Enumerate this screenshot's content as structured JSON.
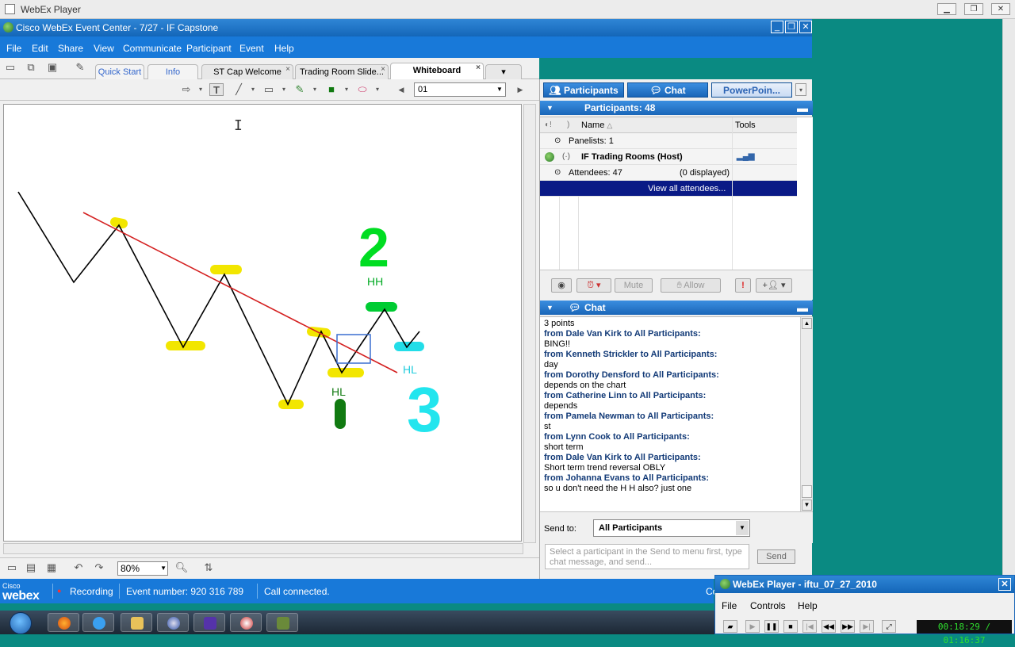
{
  "outer": {
    "title": "WebEx Player",
    "min": "▁",
    "max": "❐",
    "close": "✕"
  },
  "webex": {
    "title": "Cisco WebEx Event Center - 7/27 - IF Capstone",
    "menu": [
      "File",
      "Edit",
      "Share",
      "View",
      "Communicate",
      "Participant",
      "Event",
      "Help"
    ],
    "tabs": [
      {
        "label": "Quick Start",
        "style": "blue"
      },
      {
        "label": "Info",
        "style": "blue"
      },
      {
        "label": "ST Cap Welcome",
        "style": "normal"
      },
      {
        "label": "Trading Room Slide...",
        "style": "normal"
      },
      {
        "label": "Whiteboard",
        "style": "active"
      }
    ],
    "tab_close": "×",
    "page_value": "01",
    "zoom_value": "80%",
    "whiteboard_labels": {
      "two": "2",
      "hh": "HH",
      "hl_cyan": "HL",
      "hl_green": "HL",
      "three": "3"
    },
    "status": {
      "logo_top": "Cisco",
      "logo_bottom": "webex",
      "recording": "Recording",
      "event_number": "Event number: 920 316 789",
      "connection": "Call connected.",
      "truncated": "Co"
    }
  },
  "panel": {
    "tabs": {
      "participants": "Participants",
      "chat": "Chat",
      "powerpoint": "PowerPoin..."
    },
    "participants_header": "Participants: 48",
    "columns": {
      "name": "Name",
      "tools": "Tools"
    },
    "panelists": "Panelists: 1",
    "host": "IF Trading Rooms (Host)",
    "attendees": "Attendees: 47",
    "displayed": "(0 displayed)",
    "view_all": "View all attendees...",
    "buttons": {
      "mute": "Mute",
      "allow": "Allow"
    },
    "chat_header": "Chat",
    "chat": [
      {
        "from": "from Dale Van Kirk to All Participants:",
        "msg": "BING!!"
      },
      {
        "from": "from Kenneth Strickler to All Participants:",
        "msg": "day"
      },
      {
        "from": "from Dorothy Densford to All Participants:",
        "msg": "depends on the chart"
      },
      {
        "from": "from Catherine Linn to All Participants:",
        "msg": "depends"
      },
      {
        "from": "from Pamela Newman to All Participants:",
        "msg": "st"
      },
      {
        "from": "from Lynn Cook to All Participants:",
        "msg": "short term"
      },
      {
        "from": "from Dale Van Kirk to All Participants:",
        "msg": "Short term trend  reversal  OBLY"
      },
      {
        "from": "from Johanna Evans to All Participants:",
        "msg": "so u don't need the H H also? just one"
      }
    ],
    "chat_partial_top": "3 points",
    "send_to_label": "Send to:",
    "send_to_value": "All Participants",
    "input_placeholder": "Select a participant in the Send to menu first, type chat message, and send...",
    "send_button": "Send"
  },
  "mini_player": {
    "title": "WebEx Player - iftu_07_27_2010",
    "menu": [
      "File",
      "Controls",
      "Help"
    ],
    "timer": "00:18:29 / 01:16:37"
  }
}
